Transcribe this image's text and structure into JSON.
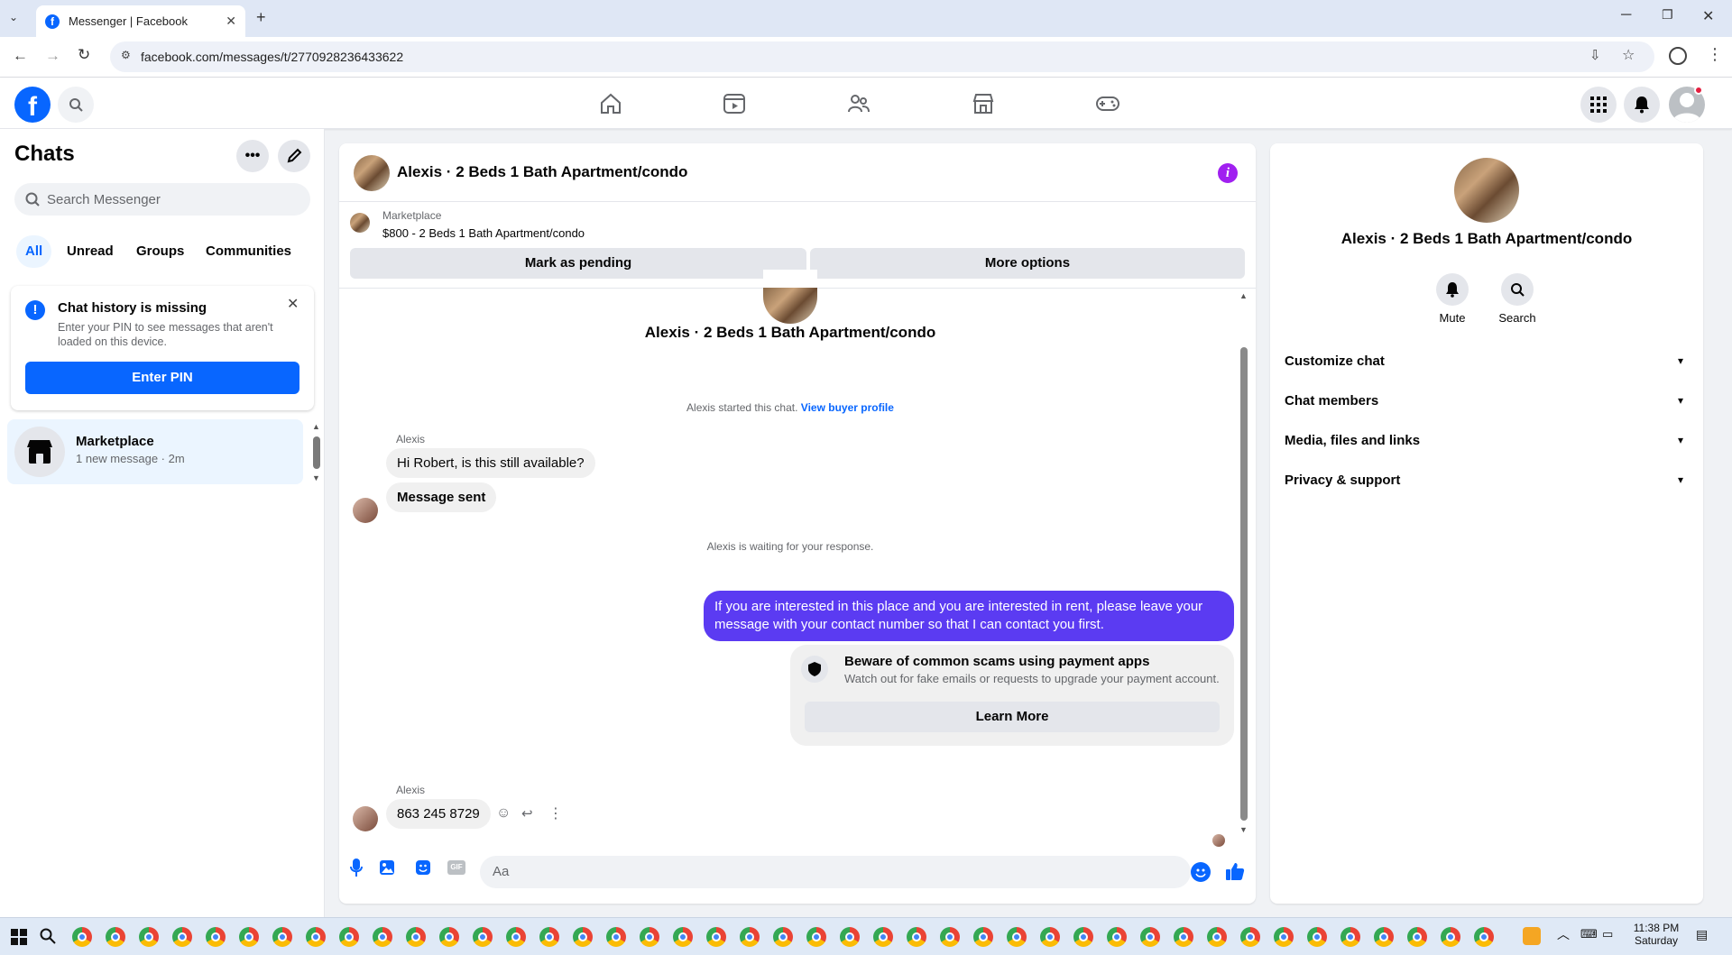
{
  "browser": {
    "tab_title": "Messenger | Facebook",
    "url": "facebook.com/messages/t/2770928236433622"
  },
  "sidebar": {
    "title": "Chats",
    "search_placeholder": "Search Messenger",
    "filters": [
      "All",
      "Unread",
      "Groups",
      "Communities"
    ],
    "notice": {
      "title": "Chat history is missing",
      "body": "Enter your PIN to see messages that aren't loaded on this device.",
      "button": "Enter PIN"
    },
    "chat_item": {
      "name": "Marketplace",
      "preview": "1 new message · 2m"
    }
  },
  "conversation": {
    "title": "Alexis · 2 Beds 1 Bath Apartment/condo",
    "listing": {
      "label": "Marketplace",
      "text": "$800 - 2 Beds 1 Bath Apartment/condo"
    },
    "mark_pending": "Mark as pending",
    "more_options": "More options",
    "intro_name": "Alexis · 2 Beds 1 Bath Apartment/condo",
    "started_text": "Alexis started this chat.",
    "view_buyer_profile": "View buyer profile",
    "sender_name_1": "Alexis",
    "msg_1": "Hi Robert, is this still available?",
    "msg_2": "Message sent",
    "waiting_text": "Alexis is waiting for your response.",
    "outgoing_msg": "If you are interested in this place and you are interested in rent, please leave your message with your contact number so that I can contact you first.",
    "warning": {
      "title": "Beware of common scams using payment apps",
      "body": "Watch out for fake emails or requests to upgrade your payment account.",
      "button": "Learn More"
    },
    "sender_name_2": "Alexis",
    "msg_3": "863 245 8729",
    "composer_placeholder": "Aa"
  },
  "details": {
    "title": "Alexis · 2 Beds 1 Bath Apartment/condo",
    "mute_label": "Mute",
    "search_label": "Search",
    "sections": [
      "Customize chat",
      "Chat members",
      "Media, files and links",
      "Privacy & support"
    ]
  },
  "taskbar": {
    "time": "11:38 PM",
    "day": "Saturday"
  },
  "colors": {
    "facebook_blue": "#0866ff",
    "outgoing_bubble": "#5b3bf2",
    "info_icon": "#a020f0"
  }
}
